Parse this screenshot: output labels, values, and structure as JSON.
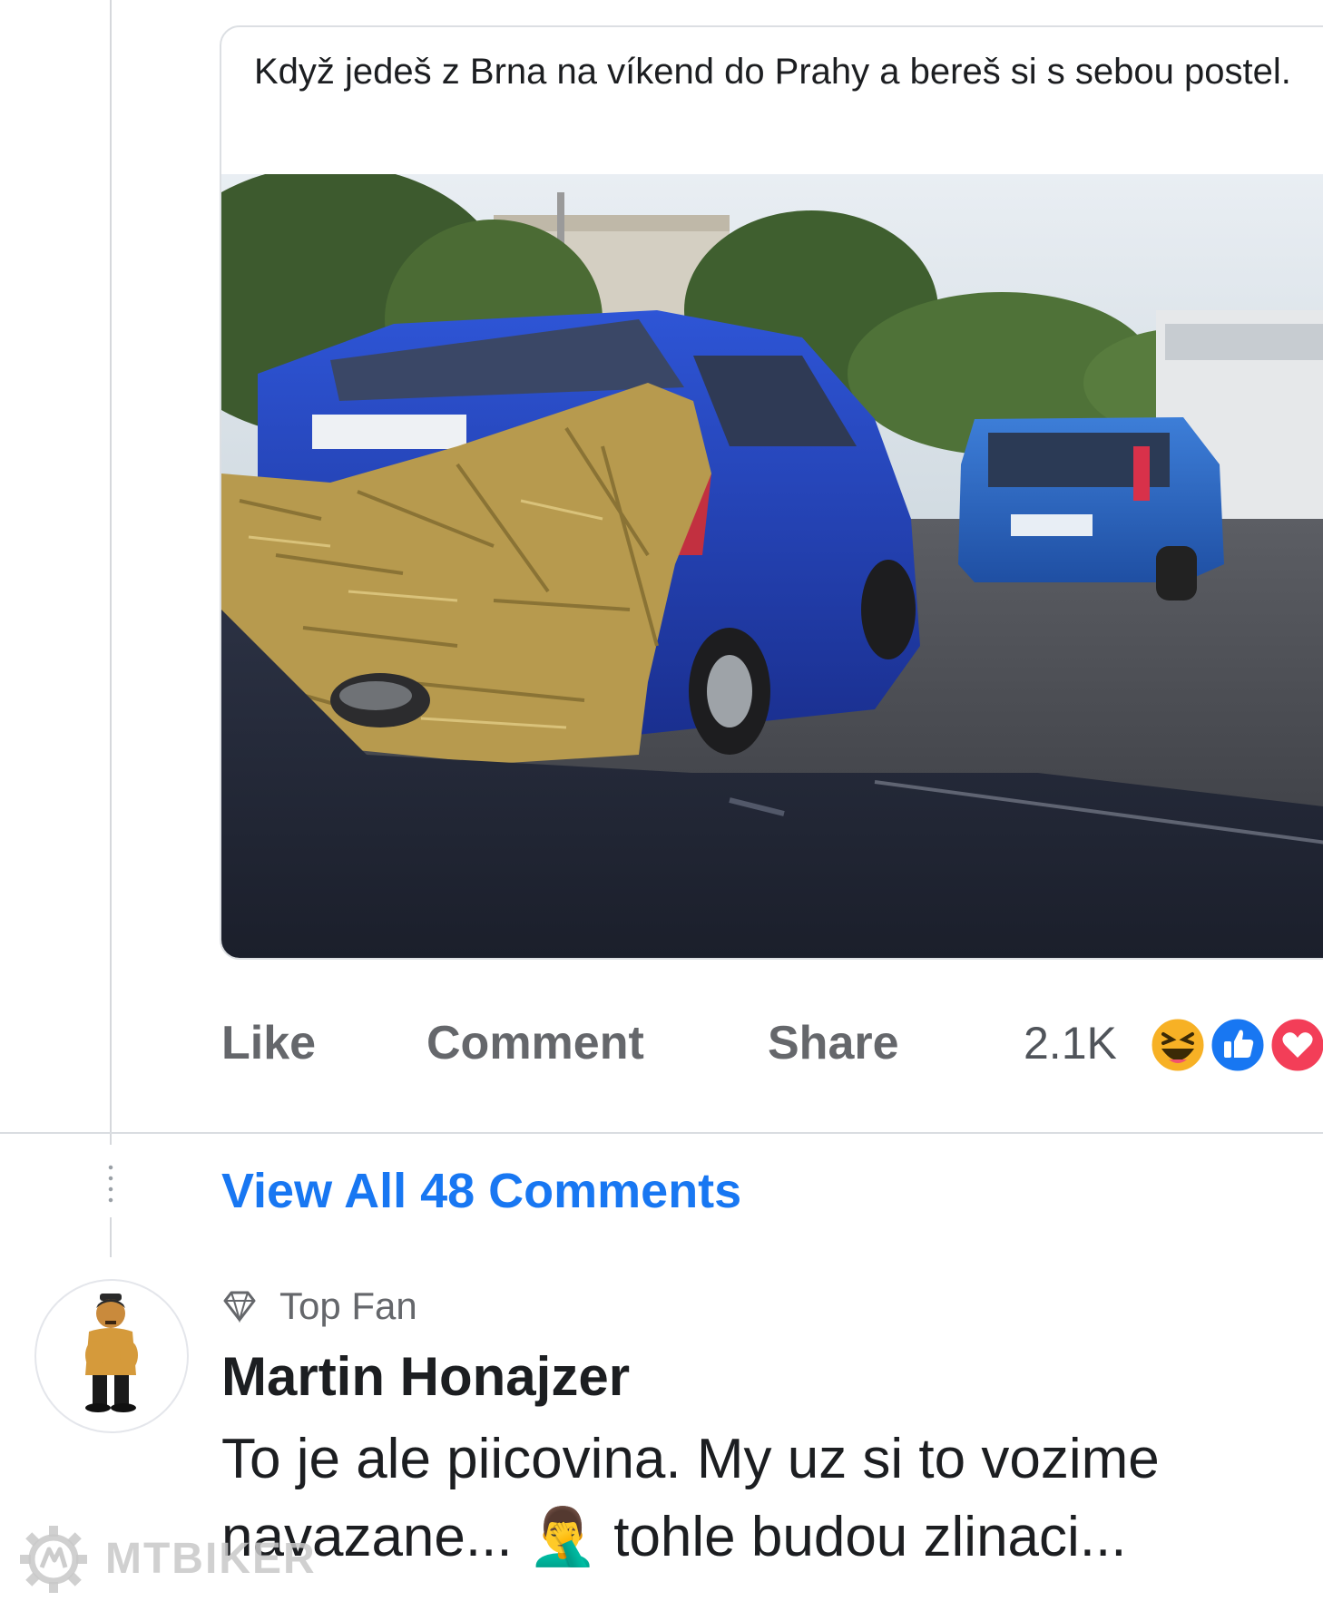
{
  "post": {
    "caption": "Když jedeš z Brna na víkend do Prahy a bereš si s sebou postel."
  },
  "actions": {
    "like_label": "Like",
    "comment_label": "Comment",
    "share_label": "Share",
    "reactions_count": "2.1K",
    "reactions": [
      "haha-icon",
      "like-icon",
      "love-icon"
    ]
  },
  "comments": {
    "view_all_label": "View All 48 Comments",
    "top_comment": {
      "badge": "Top Fan",
      "author": "Martin Honajzer",
      "text": "To je ale piicovina. My uz si to vozime navazane... 🤦‍♂️ tohle budou zlinaci..."
    }
  },
  "watermark": {
    "text": "MTBIKER"
  },
  "colors": {
    "link": "#1877f2",
    "muted": "#65676b",
    "car_blue": "#1f3fae",
    "hay": "#b79a4e"
  }
}
